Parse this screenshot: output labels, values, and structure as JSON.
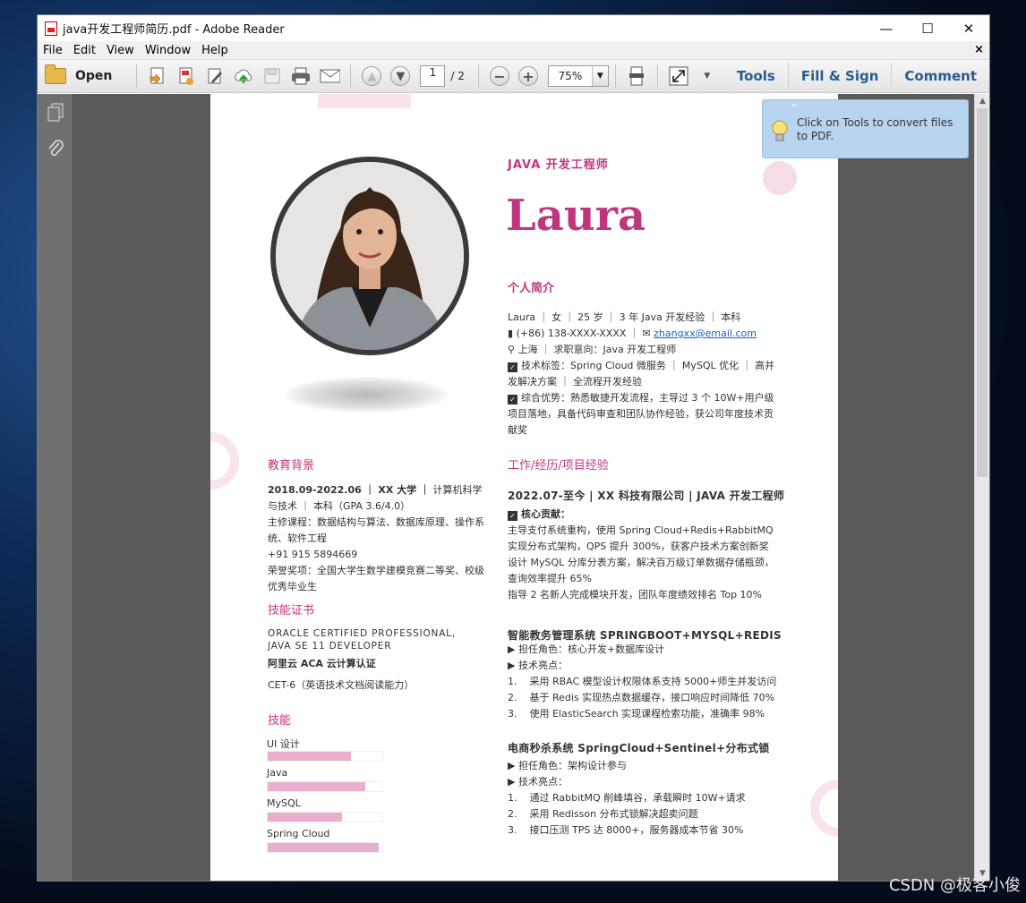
{
  "window": {
    "title": "java开发工程师简历.pdf - Adobe Reader"
  },
  "menu": {
    "items": [
      "File",
      "Edit",
      "View",
      "Window",
      "Help"
    ],
    "close": "×"
  },
  "toolbar": {
    "open_label": "Open",
    "page_current": "1",
    "page_total": "/ 2",
    "zoom": "75%",
    "tools": "Tools",
    "fill_sign": "Fill & Sign",
    "comment": "Comment"
  },
  "tooltip": {
    "text": "Click on Tools to convert files to PDF."
  },
  "resume": {
    "job_title": "JAVA 开发工程师",
    "name": "Laura",
    "profile": {
      "title": "个人简介",
      "line1": "Laura ｜ 女 ｜ 25 岁 ｜ 3 年 Java 开发经验 ｜ 本科",
      "phone": "(+86) 138-XXXX-XXXX ｜ ",
      "email": "zhangxx@email.com",
      "location": "上海 ｜ 求职意向：Java 开发工程师",
      "tags": "技术标签：Spring Cloud 微服务 ｜ MySQL 优化 ｜ 高并发解决方案 ｜ 全流程开发经验",
      "advantage": "综合优势：熟悉敏捷开发流程，主导过 3 个 10W+用户级项目落地，具备代码审查和团队协作经验，获公司年度技术贡献奖"
    },
    "education": {
      "title": "教育背景",
      "head": "2018.09-2022.06 ｜ XX 大学 ｜",
      "head_rest": " 计算机科学与技术 ｜ 本科（GPA 3.6/4.0）",
      "courses": "主修课程：数据结构与算法、数据库原理、操作系统、软件工程",
      "phone": "+91 915 5894669",
      "honors": "荣誉奖项：全国大学生数学建模竞赛二等奖、校级优秀毕业生"
    },
    "certs": {
      "title": "技能证书",
      "c1": "ORACLE CERTIFIED PROFESSIONAL, JAVA SE 11 DEVELOPER",
      "c2": "阿里云 ACA 云计算认证",
      "c3": "CET-6（英语技术文档阅读能力）"
    },
    "skills": {
      "title": "技能",
      "items": [
        {
          "label": "UI 设计",
          "level": 0.73
        },
        {
          "label": "Java",
          "level": 0.85
        },
        {
          "label": "MySQL",
          "level": 0.65
        },
        {
          "label": "Spring Cloud",
          "level": 0.97
        }
      ]
    },
    "work": {
      "title": "工作/经历/项目经验",
      "job_head": "2022.07-至今 | XX 科技有限公司 | JAVA 开发工程师",
      "contrib_label": "核心贡献：",
      "contrib_1": "主导支付系统重构，使用 Spring Cloud+Redis+RabbitMQ 实现分布式架构，QPS 提升 300%，获客户技术方案创新奖",
      "contrib_2": "设计 MySQL 分库分表方案，解决百万级订单数据存储瓶颈，查询效率提升 65%",
      "contrib_3": "指导 2 名新人完成模块开发，团队年度绩效排名 Top 10%",
      "p1_head": "智能教务管理系统 SPRINGBOOT+MYSQL+REDIS",
      "p1_role": "▶ 担任角色：核心开发+数据库设计",
      "p1_tech": "▶ 技术亮点：",
      "p1_items": [
        "1.    采用 RBAC 模型设计权限体系支持 5000+师生并发访问",
        "2.    基于 Redis 实现热点数据缓存，接口响应时间降低 70%",
        "3.    使用 ElasticSearch 实现课程检索功能，准确率 98%"
      ],
      "p2_head": "电商秒杀系统 SpringCloud+Sentinel+分布式锁",
      "p2_role": "▶ 担任角色：架构设计参与",
      "p2_tech": "▶ 技术亮点：",
      "p2_items": [
        "1.    通过 RabbitMQ 削峰填谷，承载瞬时 10W+请求",
        "2.    采用 Redisson 分布式锁解决超卖问题",
        "3.    接口压测 TPS 达 8000+，服务器成本节省 30%"
      ]
    }
  },
  "watermark": "CSDN @极客小俊"
}
